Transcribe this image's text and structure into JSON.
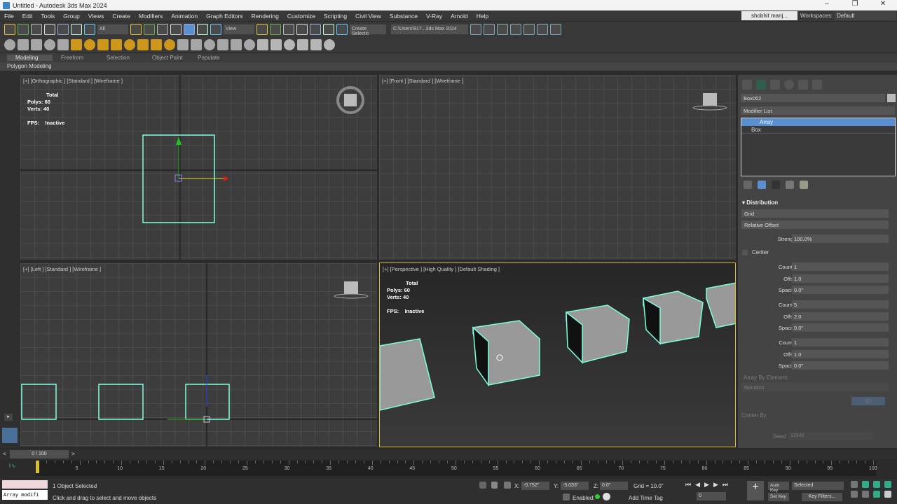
{
  "window": {
    "title": "Untitled - Autodesk 3ds Max 2024",
    "minimize": "–",
    "restore": "❐",
    "close": "✕"
  },
  "menu": [
    "File",
    "Edit",
    "Tools",
    "Group",
    "Views",
    "Create",
    "Modifiers",
    "Animation",
    "Graph Editors",
    "Rendering",
    "Customize",
    "Scripting",
    "Civil View",
    "Substance",
    "V-Ray",
    "Arnold",
    "Help"
  ],
  "user": "shobhit manj...",
  "workspaces": {
    "label": "Workspaces:",
    "value": "Default"
  },
  "toolbar1": {
    "selection_filter": "All",
    "ref_coord": "View",
    "create_selection": "Create Selectic",
    "project_path": "C:\\Users\\917...3ds Max 2024"
  },
  "toolbar1_icons": [
    "scene-explorer-icon",
    "layer-icon",
    "undo-icon",
    "redo-icon",
    "link-icon",
    "unlink-icon",
    "bind-spacewarp-icon",
    "select-object-icon",
    "select-by-name-icon",
    "rect-selection-icon",
    "window-crossing-icon",
    "move-icon",
    "rotate-icon",
    "scale-icon",
    "placement-icon",
    "pivot-icon",
    "snap-icon",
    "angle-snap-icon",
    "percent-snap-icon",
    "spinner-snap-icon",
    "named-selection-icon"
  ],
  "toolbar1_right_icons": [
    "open-project-icon",
    "new-project-icon",
    "set-project-icon",
    "project-folder-icon",
    "save-icon",
    "render-icon",
    "render-online-icon"
  ],
  "toolbar2_icons": [
    "teapot-icon",
    "sphere-icon",
    "box-icon",
    "list-icon",
    "camera-icon",
    "light-omni-icon",
    "light-dome-icon",
    "light-sphere-icon",
    "light-gem-icon",
    "light-spot-icon",
    "light-bulb-icon",
    "sun-icon",
    "sparkle-icon",
    "geometry-icon",
    "material-icon",
    "helper-icon",
    "particle-icon",
    "grass-icon",
    "fire-icon",
    "vray-sphere-icon",
    "vray-mtl-icon",
    "palette-icon",
    "render-frame-icon",
    "vfb-icon",
    "vray-logo-icon"
  ],
  "ribbon": {
    "tabs": [
      "Modeling",
      "Freeform",
      "Selection",
      "Object Paint",
      "Populate"
    ],
    "sub": "Polygon Modeling"
  },
  "viewports": {
    "top": {
      "label": "[+] [Orthographic ] [Standard ] [Wireframe ]",
      "stats": {
        "title": "Total",
        "polys_label": "Polys:",
        "polys": "60",
        "verts_label": "Verts:",
        "verts": "40",
        "fps_label": "FPS:",
        "fps": "Inactive"
      }
    },
    "front": {
      "label": "[+] [Front ] [Standard ] [Wireframe ]"
    },
    "left": {
      "label": "[+] [Left ] [Standard ] [Wireframe ]"
    },
    "perspective": {
      "label": "[+] [Perspective ] [High Quality ] [Default Shading ]",
      "stats": {
        "title": "Total",
        "polys_label": "Polys:",
        "polys": "60",
        "verts_label": "Verts:",
        "verts": "40",
        "fps_label": "FPS:",
        "fps": "Inactive"
      }
    }
  },
  "command_panel": {
    "object_name": "Box002",
    "modifier_list": "Modifier List",
    "stack": [
      "Array",
      "Box"
    ],
    "rollout": "Distribution",
    "distribution": "Grid",
    "offset_mode": "Relative Offset",
    "strength_label": "Strength",
    "strength": "100.0%",
    "center_label": "Center",
    "params": [
      {
        "k": "Count X",
        "v": "1"
      },
      {
        "k": "Offset",
        "v": "1.0"
      },
      {
        "k": "Spacing",
        "v": "0.0\""
      },
      {
        "k": "Count Y",
        "v": "5"
      },
      {
        "k": "Offset",
        "v": "2.0"
      },
      {
        "k": "Spacing",
        "v": "0.0\""
      },
      {
        "k": "Count Z",
        "v": "1"
      },
      {
        "k": "Offset",
        "v": "1.0"
      },
      {
        "k": "Spacing",
        "v": "0.0\""
      }
    ],
    "array_by_element": "Array By Element",
    "random": "Random",
    "id": "ID",
    "center_by": "Center By",
    "seed_label": "Seed",
    "seed": "12345"
  },
  "timeline": {
    "frame": "0 / 100",
    "ticks": [
      5,
      10,
      15,
      20,
      25,
      30,
      35,
      40,
      45,
      50,
      55,
      60,
      65,
      70,
      75,
      80,
      85,
      90,
      95,
      100
    ],
    "current": 0,
    "total": 100
  },
  "status": {
    "script": "Array modifi",
    "selected": "1 Object Selected",
    "prompt": "Click and drag to select and move objects",
    "x_label": "X:",
    "x": "-0.752\"",
    "y_label": "Y:",
    "y": "-5.033\"",
    "z_label": "Z:",
    "z": "0.0\"",
    "grid": "Grid = 10.0\"",
    "enabled": "Enabled:",
    "add_time_tag": "Add Time Tag",
    "auto_key": "Auto Key",
    "set_key": "Set Key",
    "key_mode": "Selected",
    "key_filters": "Key Filters...",
    "frame_value": "0"
  },
  "colors": {
    "accent": "#5a8fd0",
    "selection": "#7fffe0",
    "active_border": "#d8c030"
  }
}
